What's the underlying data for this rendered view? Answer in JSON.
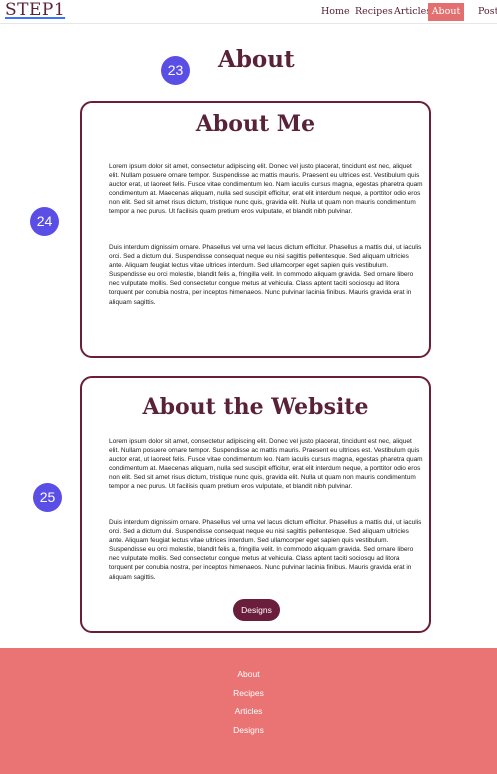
{
  "header": {
    "logo": "STEP1",
    "nav": [
      "Home",
      "Recipes",
      "Articles",
      "About",
      "Post"
    ],
    "active": "About"
  },
  "page": {
    "title": "About"
  },
  "badges": [
    "23",
    "24",
    "25"
  ],
  "sections": [
    {
      "title": "About Me",
      "paragraphs": [
        "Lorem ipsum dolor sit amet, consectetur adipiscing elit. Donec vel justo placerat, tincidunt est nec, aliquet elit. Nullam posuere ornare tempor. Suspendisse ac mattis mauris. Praesent eu ultrices est. Vestibulum quis auctor erat, ut laoreet felis. Fusce vitae condimentum leo. Nam iaculis cursus magna, egestas pharetra quam condimentum at. Maecenas aliquam, nulla sed suscipit efficitur, erat elit interdum neque, a porttitor odio eros non elit. Sed sit amet risus dictum, tristique nunc quis, gravida elit. Nulla ut quam non mauris condimentum tempor a nec purus. Ut facilisis quam pretium eros vulputate, et blandit nibh pulvinar.",
        "Duis interdum dignissim ornare. Phasellus vel urna vel lacus dictum efficitur. Phasellus a mattis dui, ut iaculis orci. Sed a dictum dui. Suspendisse consequat neque eu nisi sagittis pellentesque. Sed aliquam ultricies ante. Aliquam feugiat lectus vitae ultrices interdum. Sed ullamcorper eget sapien quis vestibulum. Suspendisse eu orci molestie, blandit felis a, fringilla velit. In commodo aliquam gravida. Sed ornare libero nec vulputate mollis. Sed consectetur congue metus at vehicula. Class aptent taciti sociosqu ad litora torquent per conubia nostra, per inceptos himenaeos. Nunc pulvinar lacinia finibus. Mauris gravida erat in aliquam sagittis."
      ]
    },
    {
      "title": "About the Website",
      "paragraphs": [
        "Lorem ipsum dolor sit amet, consectetur adipiscing elit. Donec vel justo placerat, tincidunt est nec, aliquet elit. Nullam posuere ornare tempor. Suspendisse ac mattis mauris. Praesent eu ultrices est. Vestibulum quis auctor erat, ut laoreet felis. Fusce vitae condimentum leo. Nam iaculis cursus magna, egestas pharetra quam condimentum at. Maecenas aliquam, nulla sed suscipit efficitur, erat elit interdum neque, a porttitor odio eros non elit. Sed sit amet risus dictum, tristique nunc quis, gravida elit. Nulla ut quam non mauris condimentum tempor a nec purus. Ut facilisis quam pretium eros vulputate, et blandit nibh pulvinar.",
        "Duis interdum dignissim ornare. Phasellus vel urna vel lacus dictum efficitur. Phasellus a mattis dui, ut iaculis orci. Sed a dictum dui. Suspendisse consequat neque eu nisi sagittis pellentesque. Sed aliquam ultricies ante. Aliquam feugiat lectus vitae ultrices interdum. Sed ullamcorper eget sapien quis vestibulum. Suspendisse eu orci molestie, blandit felis a, fringilla velit. In commodo aliquam gravida. Sed ornare libero nec vulputate mollis. Sed consectetur congue metus at vehicula. Class aptent taciti sociosqu ad litora torquent per conubia nostra, per inceptos himenaeos. Nunc pulvinar lacinia finibus. Mauris gravida erat in aliquam sagittis."
      ],
      "button": "Designs"
    }
  ],
  "footer": {
    "links": [
      "About",
      "Recipes",
      "Articles",
      "Designs"
    ]
  },
  "colors": {
    "brand": "#5a2238",
    "accent": "#e37070",
    "footer": "#ea7373",
    "badge": "#5b4ee6"
  }
}
